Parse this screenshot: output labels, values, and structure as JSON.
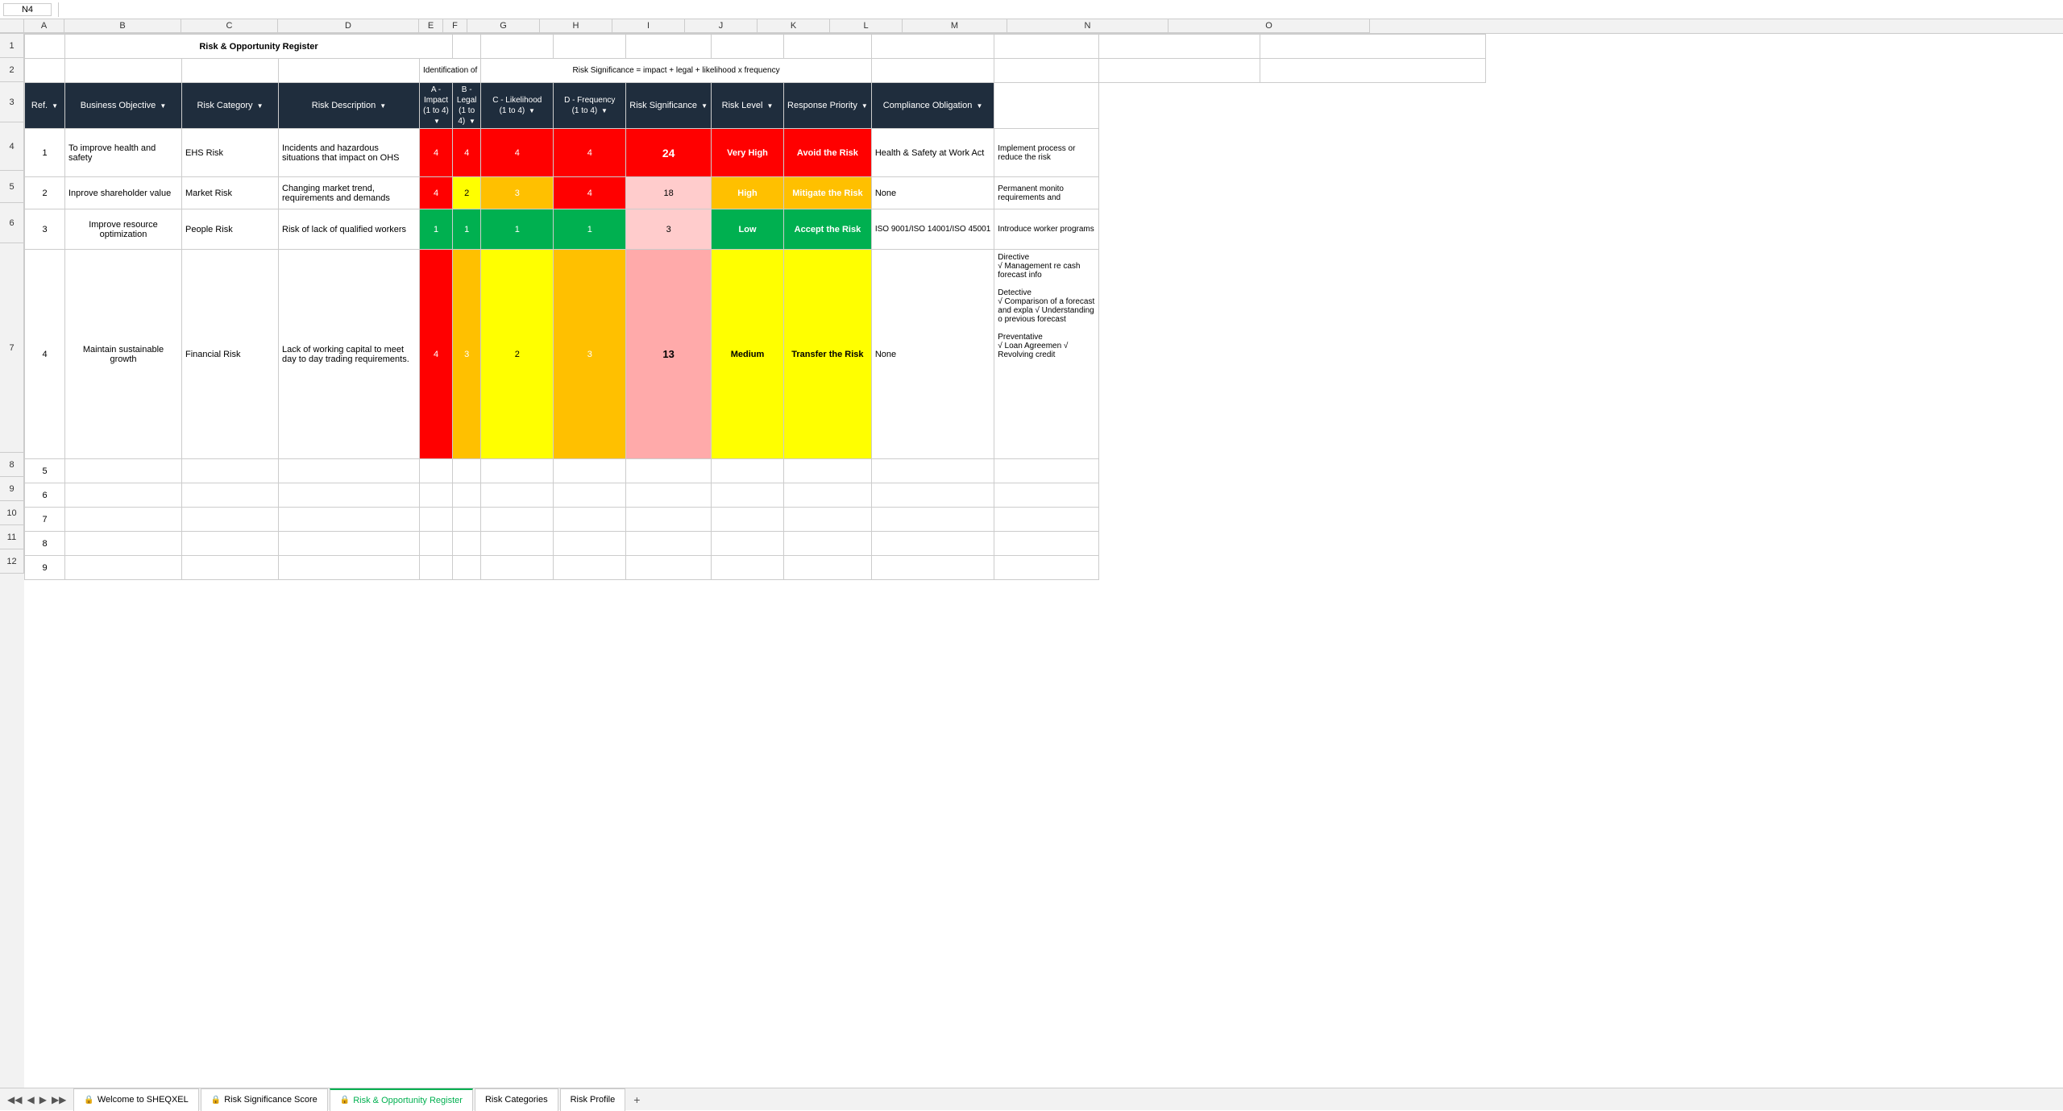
{
  "title": "Risk & Opportunity Register",
  "formula_bar": {
    "name_box": "N4",
    "formula": ""
  },
  "header_row1": {
    "title": "Risk & Opportunity Register"
  },
  "header_row2": {
    "identification": "Identification of",
    "risk_significance": "Risk Significance = impact + legal + likelihood x  frequency"
  },
  "col_headers": [
    "A",
    "B",
    "C",
    "D",
    "E",
    "F",
    "G",
    "H",
    "I",
    "J",
    "K",
    "L",
    "M",
    "N"
  ],
  "col3_headers": {
    "ref": "Ref.",
    "business_objective": "Business Objective",
    "risk_category": "Risk Category",
    "risk_description": "Risk Description",
    "a_impact": "A - Impact\n(1 to 4)",
    "b_legal": "B - Legal\n(1 to 4)",
    "c_likelihood": "C - Likelihood\n(1 to 4)",
    "d_frequency": "D - Frequency\n(1 to 4)",
    "risk_significance": "Risk Significance",
    "risk_level": "Risk Level",
    "response_priority": "Response Priority",
    "compliance_obligation": "Compliance Obligation"
  },
  "rows": [
    {
      "ref": "1",
      "business_objective": "To improve health and safety",
      "risk_category": "EHS Risk",
      "risk_description": "Incidents and hazardous situations that impact on OHS",
      "a_impact": "4",
      "b_legal": "4",
      "c_likelihood": "4",
      "d_frequency": "4",
      "risk_significance": "24",
      "risk_level": "Very High",
      "response_priority": "Avoid the Risk",
      "compliance_obligation": "Health & Safety at Work Act",
      "compliance_notes": "Implement process or reduce the risk"
    },
    {
      "ref": "2",
      "business_objective": "Inprove shareholder value",
      "risk_category": "Market Risk",
      "risk_description": "Changing market trend, requirements and demands",
      "a_impact": "4",
      "b_legal": "2",
      "c_likelihood": "3",
      "d_frequency": "4",
      "risk_significance": "18",
      "risk_level": "High",
      "response_priority": "Mitigate the Risk",
      "compliance_obligation": "None",
      "compliance_notes": "Permanent monito requirements and"
    },
    {
      "ref": "3",
      "business_objective": "Improve resource optimization",
      "risk_category": "People Risk",
      "risk_description": "Risk of lack of qualified workers",
      "a_impact": "1",
      "b_legal": "1",
      "c_likelihood": "1",
      "d_frequency": "1",
      "risk_significance": "3",
      "risk_level": "Low",
      "response_priority": "Accept the Risk",
      "compliance_obligation": "ISO 9001/ISO 14001/ISO 45001",
      "compliance_notes": "Introduce worker programs"
    },
    {
      "ref": "4",
      "business_objective": "Maintain sustainable growth",
      "risk_category": "Financial Risk",
      "risk_description": "Lack of working capital to meet day to day trading requirements.",
      "a_impact": "4",
      "b_legal": "3",
      "c_likelihood": "2",
      "d_frequency": "3",
      "risk_significance": "13",
      "risk_level": "Medium",
      "response_priority": "Transfer the Risk",
      "compliance_obligation": "None",
      "compliance_notes": "Directive\n√ Management re cash forecast info\n\nDetective\n√ Comparison of a forecast and expla √ Understanding o previous forecast\n\nPreventative\n√ Loan Agreemen √ Revolving credit"
    }
  ],
  "empty_rows": [
    "5",
    "6",
    "7",
    "8",
    "9"
  ],
  "tabs": [
    {
      "label": "Welcome to SHEQXEL",
      "locked": true,
      "active": false
    },
    {
      "label": "Risk Significance Score",
      "locked": true,
      "active": false
    },
    {
      "label": "Risk & Opportunity Register",
      "locked": true,
      "active": true
    },
    {
      "label": "Risk Categories",
      "locked": false,
      "active": false
    },
    {
      "label": "Risk Profile",
      "locked": false,
      "active": false
    }
  ]
}
